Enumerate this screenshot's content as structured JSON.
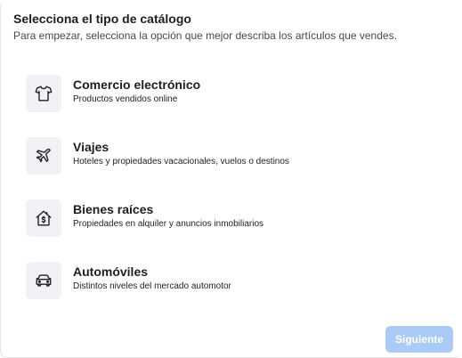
{
  "header": {
    "title": "Selecciona el tipo de catálogo",
    "subtitle": "Para empezar, selecciona la opción que mejor describa los artículos que vendes."
  },
  "options": [
    {
      "title": "Comercio electrónico",
      "description": "Productos vendidos online",
      "icon": "tshirt-icon"
    },
    {
      "title": "Viajes",
      "description": "Hoteles y propiedades vacacionales, vuelos o destinos",
      "icon": "airplane-icon"
    },
    {
      "title": "Bienes raíces",
      "description": "Propiedades en alquiler y anuncios inmobiliarios",
      "icon": "house-dollar-icon"
    },
    {
      "title": "Automóviles",
      "description": "Distintos niveles del mercado automotor",
      "icon": "car-icon"
    }
  ],
  "footer": {
    "next_label": "Siguiente",
    "next_enabled": false
  },
  "colors": {
    "icon_background": "#f0f2f5",
    "button_disabled": "#aacbf6",
    "text": "#1c1e21"
  }
}
